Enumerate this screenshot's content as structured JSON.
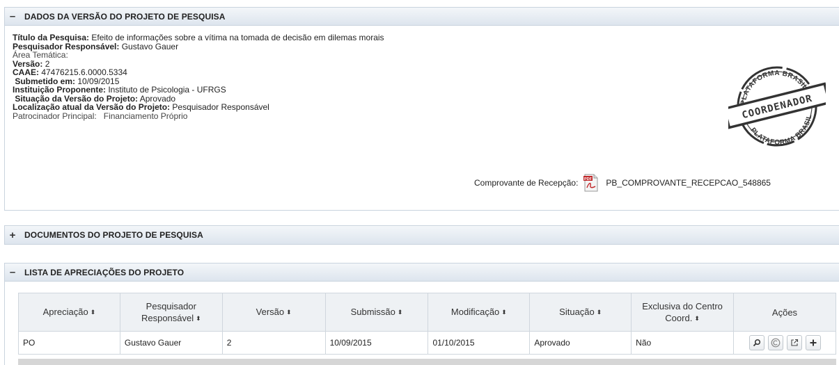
{
  "panels": {
    "dados": {
      "toggle": "–",
      "title": "DADOS DA VERSÃO DO PROJETO DE PESQUISA"
    },
    "documentos": {
      "toggle": "+",
      "title": "DOCUMENTOS DO PROJETO DE PESQUISA"
    },
    "lista": {
      "toggle": "–",
      "title": "LISTA DE APRECIAÇÕES DO PROJETO"
    }
  },
  "projeto": {
    "titulo_label": "Título da Pesquisa:",
    "titulo_value": " Efeito de informações sobre a vítima na tomada de decisão em dilemas morais",
    "pesquisador_label": "Pesquisador Responsável:",
    "pesquisador_value": " Gustavo Gauer",
    "area_label": "Área Temática:",
    "versao_label": "Versão:",
    "versao_value": " 2",
    "caae_label": "CAAE:",
    "caae_value": " 47476215.6.0000.5334",
    "submetido_label": " Submetido em:",
    "submetido_value": " 10/09/2015",
    "instituicao_label": "Instituição Proponente:",
    "instituicao_value": " Instituto de Psicologia - UFRGS",
    "situacao_label": " Situação da Versão do Projeto:",
    "situacao_value": " Aprovado",
    "localizacao_label": "Localização atual da Versão do Projeto:",
    "localizacao_value": " Pesquisador Responsável",
    "patrocinador_label": "Patrocinador Principal:",
    "patrocinador_value": "   Financiamento Próprio"
  },
  "stamp": {
    "top_text": "PLATAFORMA BRASIL",
    "center_text": "COORDENADOR",
    "bottom_text": "PLATAFORMA BRASIL"
  },
  "comprovante": {
    "label": "Comprovante de Recepção:",
    "pdf_badge": "PDF",
    "filename": "PB_COMPROVANTE_RECEPCAO_548865"
  },
  "tabela": {
    "headers": [
      "Apreciação",
      "Pesquisador Responsável",
      "Versão",
      "Submissão",
      "Modificação",
      "Situação",
      "Exclusiva do Centro Coord.",
      "Ações"
    ],
    "sort_glyph": "⬍",
    "rows": [
      {
        "apreciacao": "PO",
        "pesquisador": "Gustavo Gauer",
        "versao": "2",
        "submissao": "10/09/2015",
        "modificacao": "01/10/2015",
        "situacao": "Aprovado",
        "exclusiva": "Não"
      }
    ],
    "action_icons": [
      "search-icon",
      "copyright-icon",
      "external-link-icon",
      "plus-icon"
    ]
  }
}
